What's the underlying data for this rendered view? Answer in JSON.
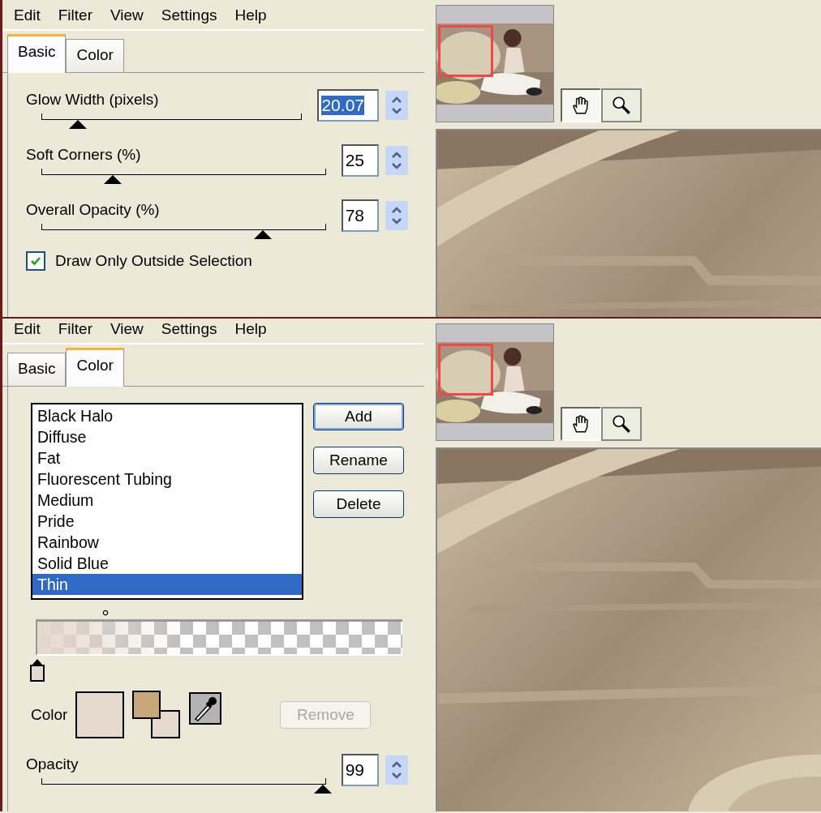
{
  "panels": [
    {
      "kind": "basic",
      "menu": [
        "Edit",
        "Filter",
        "View",
        "Settings",
        "Help"
      ],
      "tabs": [
        {
          "label": "Basic",
          "selected": true
        },
        {
          "label": "Color",
          "selected": false
        }
      ],
      "sliders": [
        {
          "label": "Glow Width (pixels)",
          "value": "20.07",
          "selected": true,
          "level": 0.14
        },
        {
          "label": "Soft Corners (%)",
          "value": "25",
          "selected": false,
          "level": 0.25
        },
        {
          "label": "Overall Opacity (%)",
          "value": "78",
          "selected": false,
          "level": 0.78
        }
      ],
      "checkbox": {
        "label": "Draw Only Outside Selection",
        "checked": true
      }
    },
    {
      "kind": "color",
      "menu": [
        "Edit",
        "Filter",
        "View",
        "Settings",
        "Help"
      ],
      "tabs": [
        {
          "label": "Basic",
          "selected": false
        },
        {
          "label": "Color",
          "selected": true
        }
      ],
      "presets": [
        {
          "label": "Black Halo",
          "selected": false
        },
        {
          "label": "Diffuse",
          "selected": false
        },
        {
          "label": "Fat",
          "selected": false
        },
        {
          "label": "Fluorescent Tubing",
          "selected": false
        },
        {
          "label": "Medium",
          "selected": false
        },
        {
          "label": "Pride",
          "selected": false
        },
        {
          "label": "Rainbow",
          "selected": false
        },
        {
          "label": "Solid Blue",
          "selected": false
        },
        {
          "label": "Thin",
          "selected": true
        }
      ],
      "buttons": [
        {
          "label": "Add",
          "default": true,
          "disabled": false
        },
        {
          "label": "Rename",
          "default": false,
          "disabled": false
        },
        {
          "label": "Delete",
          "default": false,
          "disabled": false
        }
      ],
      "color_label": "Color",
      "swatches": {
        "current": {
          "color": "#e5d8cc"
        },
        "foreground": {
          "color": "#c8a77c"
        },
        "background": {
          "color": "#e5d8cc"
        }
      },
      "remove_button": {
        "label": "Remove",
        "disabled": true
      },
      "opacity": {
        "label": "Opacity",
        "value": "99",
        "level": 0.99
      }
    }
  ]
}
